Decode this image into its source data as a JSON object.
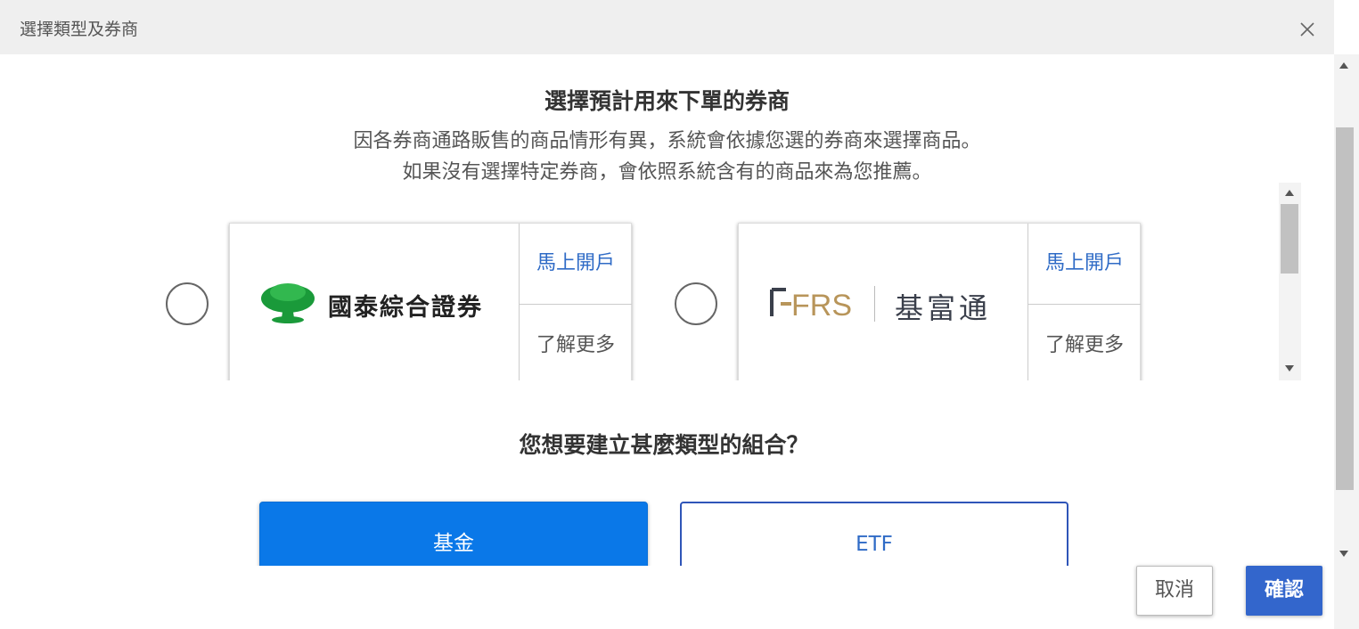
{
  "dialog": {
    "title": "選擇類型及券商"
  },
  "broker_section": {
    "heading": "選擇預計用來下單的券商",
    "desc_line1": "因各券商通路販售的商品情形有異，系統會依據您選的券商來選擇商品。",
    "desc_line2": "如果沒有選擇特定券商，會依照系統含有的商品來為您推薦。",
    "brokers": [
      {
        "name": "國泰綜合證券",
        "open_account_label": "馬上開戶",
        "learn_more_label": "了解更多",
        "logo_color": "#1a9a3a"
      },
      {
        "name": "基富通",
        "logo_mark": "FRS",
        "open_account_label": "馬上開戶",
        "learn_more_label": "了解更多",
        "logo_color": "#b8955a"
      }
    ]
  },
  "type_section": {
    "heading": "您想要建立甚麼類型的組合？",
    "options": [
      {
        "label": "基金",
        "selected": true
      },
      {
        "label": "ETF",
        "selected": false
      }
    ]
  },
  "footer": {
    "cancel_label": "取消",
    "confirm_label": "確認"
  },
  "colors": {
    "accent": "#3366cc",
    "selected_fill": "#0a78e8",
    "link": "#2f6bc6"
  }
}
